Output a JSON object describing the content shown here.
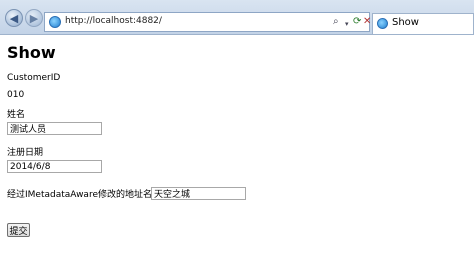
{
  "browser": {
    "url": "http://localhost:4882/",
    "tab_title": "Show",
    "back_glyph": "◀",
    "forward_glyph": "▶"
  },
  "page": {
    "title": "Show",
    "customer_id_label": "CustomerID",
    "customer_id_value": "010",
    "name_label": "姓名",
    "name_value": "测试人员",
    "register_date_label": "注册日期",
    "register_date_value": "2014/6/8",
    "address_label": "经过IMetadataAware修改的地址名称",
    "address_value": "天空之城",
    "submit_label": "提交"
  },
  "icons": {
    "page_icon": "ie-page-icon",
    "tab_icon": "ie-page-icon",
    "search": "search-icon",
    "refresh": "refresh-icon",
    "stop": "stop-icon"
  },
  "colors": {
    "chrome": "#c3d3e7",
    "input_border": "#a8a8a8"
  }
}
